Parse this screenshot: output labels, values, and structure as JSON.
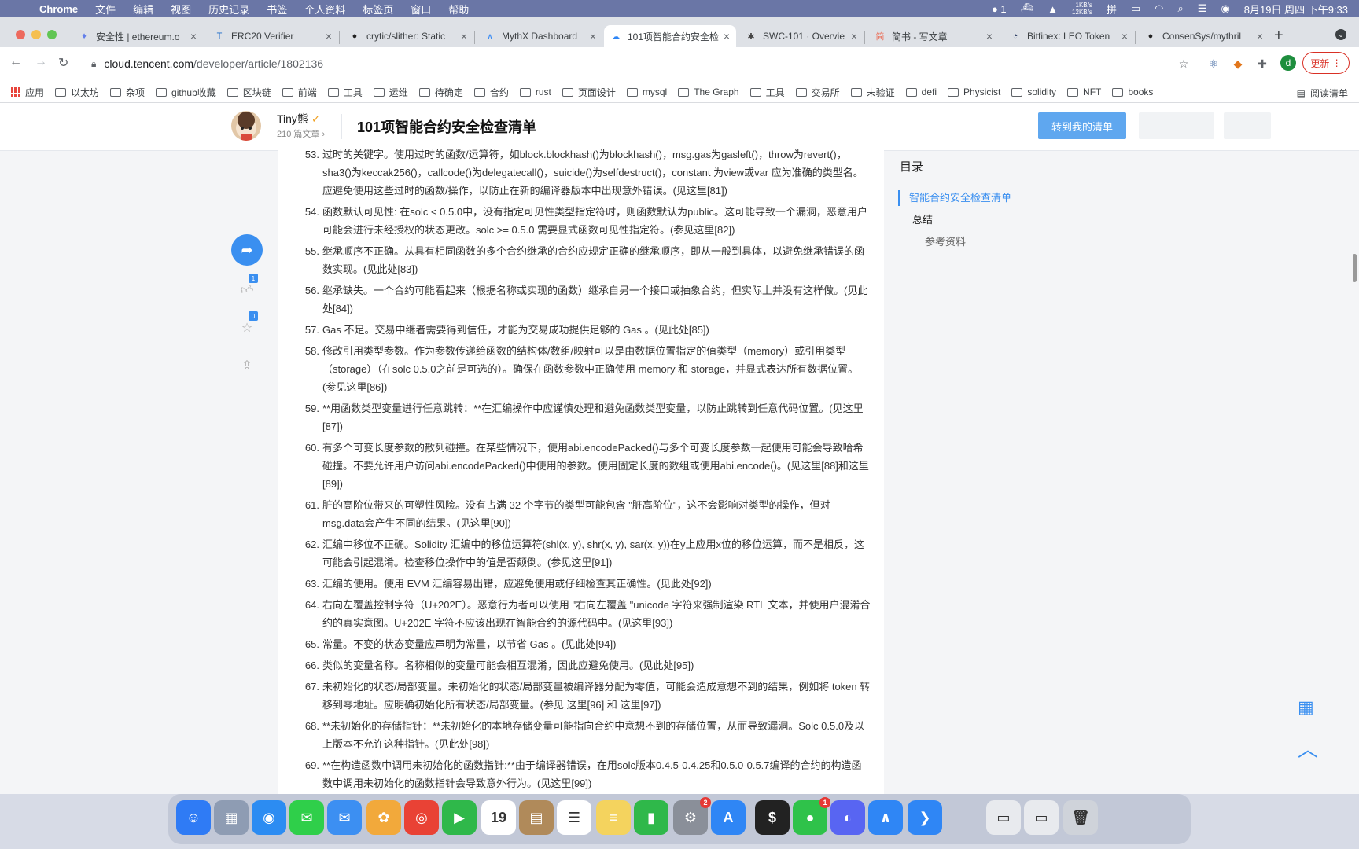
{
  "menubar": {
    "app": "Chrome",
    "items": [
      "文件",
      "编辑",
      "视图",
      "历史记录",
      "书签",
      "个人资料",
      "标签页",
      "窗口",
      "帮助"
    ],
    "wechat_count": "1",
    "net_up": "1KB/s",
    "net_down": "12KB/s",
    "datetime": "8月19日 周四 下午9:33"
  },
  "tabs": [
    {
      "label": "安全性 | ethereum.o",
      "icon": "ethereum-icon"
    },
    {
      "label": "ERC20 Verifier",
      "icon": "erc20-icon"
    },
    {
      "label": "crytic/slither: Static",
      "icon": "github-icon"
    },
    {
      "label": "MythX Dashboard",
      "icon": "mythx-icon"
    },
    {
      "label": "101项智能合约安全检",
      "icon": "tencent-cloud-icon"
    },
    {
      "label": "SWC-101 · Overvie",
      "icon": "swc-icon"
    },
    {
      "label": "简书 - 写文章",
      "icon": "jianshu-icon"
    },
    {
      "label": "Bitfinex: LEO Token",
      "icon": "etherscan-icon"
    },
    {
      "label": "ConsenSys/mythril",
      "icon": "github-icon"
    }
  ],
  "omnibox": {
    "host": "cloud.tencent.com",
    "path": "/developer/article/1802136"
  },
  "profile_initial": "d",
  "update_label": "更新",
  "bookmarks": [
    "应用",
    "以太坊",
    "杂项",
    "github收藏",
    "区块链",
    "前端",
    "工具",
    "运维",
    "待确定",
    "合约",
    "rust",
    "页面设计",
    "mysql",
    "The Graph",
    "工具",
    "交易所",
    "未验证",
    "defi",
    "Physicist",
    "solidity",
    "NFT",
    "books"
  ],
  "reading_list": "阅读清单",
  "header": {
    "author": "Tiny熊",
    "author_stats": "210 篇文章 ›",
    "title": "101项智能合约安全检查清单",
    "primary_button": "转到我的清单"
  },
  "actions": {
    "like_count": "1",
    "fav_count": "0"
  },
  "toc": {
    "title": "目录",
    "items": [
      {
        "label": "智能合约安全检查清单",
        "level": 1,
        "active": true
      },
      {
        "label": "总结",
        "level": 2,
        "active": false
      },
      {
        "label": "参考资料",
        "level": 3,
        "active": false
      }
    ]
  },
  "items": [
    {
      "num": "53.",
      "text": "过时的关键字。使用过时的函数/运算符，如block.blockhash()为blockhash()，msg.gas为gasleft()，throw为revert()，sha3()为keccak256()，callcode()为delegatecall()，suicide()为selfdestruct()，constant 为view或var 应为准确的类型名。应避免使用这些过时的函数/操作，以防止在新的编译器版本中出现意外错误。(见这里[81])"
    },
    {
      "num": "54.",
      "text": "函数默认可见性: 在solc < 0.5.0中，没有指定可见性类型指定符时，则函数默认为public。这可能导致一个漏洞，恶意用户可能会进行未经授权的状态更改。solc >= 0.5.0 需要显式函数可见性指定符。(参见这里[82])"
    },
    {
      "num": "55.",
      "text": "继承顺序不正确。从具有相同函数的多个合约继承的合约应规定正确的继承顺序，即从一般到具体，以避免继承错误的函数实现。(见此处[83])"
    },
    {
      "num": "56.",
      "text": "继承缺失。一个合约可能看起来（根据名称或实现的函数）继承自另一个接口或抽象合约，但实际上并没有这样做。(见此处[84])"
    },
    {
      "num": "57.",
      "text": "Gas 不足。交易中继者需要得到信任，才能为交易成功提供足够的 Gas 。(见此处[85])"
    },
    {
      "num": "58.",
      "text": "修改引用类型参数。作为参数传递给函数的结构体/数组/映射可以是由数据位置指定的值类型（memory）或引用类型（storage）（在solc 0.5.0之前是可选的）。确保在函数参数中正确使用 memory 和 storage，并显式表达所有数据位置。(参见这里[86])"
    },
    {
      "num": "59.",
      "text": "**用函数类型变量进行任意跳转：**在汇编操作中应谨慎处理和避免函数类型变量，以防止跳转到任意代码位置。(见这里[87])"
    },
    {
      "num": "60.",
      "text": "有多个可变长度参数的散列碰撞。在某些情况下，使用abi.encodePacked()与多个可变长度参数一起使用可能会导致哈希碰撞。不要允许用户访问abi.encodePacked()中使用的参数。使用固定长度的数组或使用abi.encode()。(见这里[88]和这里[89])"
    },
    {
      "num": "61.",
      "text": "脏的高阶位带来的可塑性风险。没有占满 32 个字节的类型可能包含 \"脏高阶位\"，这不会影响对类型的操作，但对msg.data会产生不同的结果。(见这里[90])"
    },
    {
      "num": "62.",
      "text": "汇编中移位不正确。Solidity 汇编中的移位运算符(shl(x, y), shr(x, y), sar(x, y))在y上应用x位的移位运算，而不是相反，这可能会引起混淆。检查移位操作中的值是否颠倒。(参见这里[91])"
    },
    {
      "num": "63.",
      "text": "汇编的使用。使用 EVM 汇编容易出错，应避免使用或仔细检查其正确性。(见此处[92])"
    },
    {
      "num": "64.",
      "text": "右向左覆盖控制字符（U+202E）。恶意行为者可以使用 \"右向左覆盖 \"unicode 字符来强制渲染 RTL 文本，并使用户混淆合约的真实意图。U+202E 字符不应该出现在智能合约的源代码中。(见这里[93])"
    },
    {
      "num": "65.",
      "text": "常量。不变的状态变量应声明为常量，以节省 Gas 。(见此处[94])"
    },
    {
      "num": "66.",
      "text": "类似的变量名称。名称相似的变量可能会相互混淆，因此应避免使用。(见此处[95])"
    },
    {
      "num": "67.",
      "text": "未初始化的状态/局部变量。未初始化的状态/局部变量被编译器分配为零值，可能会造成意想不到的结果，例如将 token 转移到零地址。应明确初始化所有状态/局部变量。(参见 这里[96] 和 这里[97])"
    },
    {
      "num": "68.",
      "text": "**未初始化的存储指针：**未初始化的本地存储变量可能指向合约中意想不到的存储位置，从而导致漏洞。Solc 0.5.0及以上版本不允许这种指针。(见此处[98])"
    },
    {
      "num": "69.",
      "text": "**在构造函数中调用未初始化的函数指针:**由于编译器错误，在用solc版本0.4.5-0.4.25和0.5.0-0.5.7编译的合约的构造函数中调用未初始化的函数指针会导致意外行为。(见这里[99])"
    }
  ],
  "dock": [
    {
      "name": "finder",
      "color": "#2f7bf5",
      "glyph": "☺"
    },
    {
      "name": "launchpad",
      "color": "#8e9cb3",
      "glyph": "▦"
    },
    {
      "name": "safari",
      "color": "#2c8cf2",
      "glyph": "◉"
    },
    {
      "name": "messages",
      "color": "#2fcf4a",
      "glyph": "✉"
    },
    {
      "name": "mail",
      "color": "#3c8ff2",
      "glyph": "✉"
    },
    {
      "name": "photos",
      "color": "#f2a93b",
      "glyph": "✿"
    },
    {
      "name": "chrome",
      "color": "#e94235",
      "glyph": "◎"
    },
    {
      "name": "facetime",
      "color": "#2fb84a",
      "glyph": "▶"
    },
    {
      "name": "calendar",
      "color": "#ffffff",
      "glyph": "19"
    },
    {
      "name": "notes-brown",
      "color": "#b08a5a",
      "glyph": "▤"
    },
    {
      "name": "reminders",
      "color": "#ffffff",
      "glyph": "☰"
    },
    {
      "name": "notes",
      "color": "#f4d35e",
      "glyph": "≡"
    },
    {
      "name": "numbers",
      "color": "#2fb84a",
      "glyph": "▮"
    },
    {
      "name": "system-preferences",
      "color": "#8a8f99",
      "glyph": "⚙",
      "badge": "2"
    },
    {
      "name": "app-store",
      "color": "#2f86f5",
      "glyph": "A"
    },
    {
      "name": "terminal",
      "color": "#222222",
      "glyph": "$"
    },
    {
      "name": "wechat",
      "color": "#2fc24a",
      "glyph": "●",
      "badge": "1"
    },
    {
      "name": "discord",
      "color": "#5865f2",
      "glyph": "◐"
    },
    {
      "name": "mythx",
      "color": "#2f86f5",
      "glyph": "∧"
    },
    {
      "name": "vscode",
      "color": "#2f86f5",
      "glyph": "❯"
    },
    {
      "name": "preview",
      "color": "#e8eaee",
      "glyph": "▭"
    },
    {
      "name": "downloads",
      "color": "#e8eaee",
      "glyph": "▭"
    },
    {
      "name": "trash",
      "color": "#cfd3da",
      "glyph": "🗑"
    }
  ]
}
